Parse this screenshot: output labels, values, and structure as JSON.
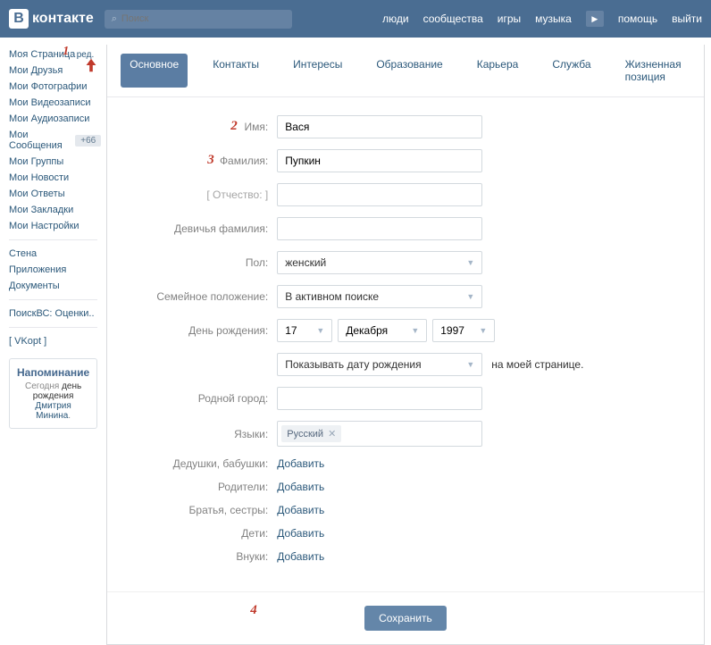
{
  "header": {
    "logo_text": "контакте",
    "search_placeholder": "Поиск",
    "nav": {
      "people": "люди",
      "communities": "сообщества",
      "games": "игры",
      "music": "музыка",
      "help": "помощь",
      "logout": "выйти"
    }
  },
  "sidebar": {
    "my_page": "Моя Страница",
    "edit": "ред.",
    "friends": "Мои Друзья",
    "photos": "Мои Фотографии",
    "videos": "Мои Видеозаписи",
    "audio": "Мои Аудиозаписи",
    "messages": "Мои Сообщения",
    "messages_badge": "+66",
    "groups": "Мои Группы",
    "news": "Мои Новости",
    "answers": "Мои Ответы",
    "bookmarks": "Мои Закладки",
    "settings": "Мои Настройки",
    "wall": "Стена",
    "apps": "Приложения",
    "docs": "Документы",
    "search_vs": "ПоискВС: Оценки..",
    "vkopt": "[ VKopt ]",
    "reminder": {
      "title": "Напоминание",
      "prefix": "Сегодня",
      "mid": "день рождения",
      "name": "Дмитрия Минина",
      "suffix": "."
    }
  },
  "tabs": {
    "main": "Основное",
    "contacts": "Контакты",
    "interests": "Интересы",
    "education": "Образование",
    "career": "Карьера",
    "military": "Служба",
    "life": "Жизненная позиция"
  },
  "form": {
    "name_label": "Имя:",
    "name_value": "Вася",
    "surname_label": "Фамилия:",
    "surname_value": "Пупкин",
    "patronymic_label": "[ Отчество: ]",
    "maiden_label": "Девичья фамилия:",
    "gender_label": "Пол:",
    "gender_value": "женский",
    "marital_label": "Семейное положение:",
    "marital_value": "В активном поиске",
    "bday_label": "День рождения:",
    "bday_day": "17",
    "bday_month": "Декабря",
    "bday_year": "1997",
    "bday_show": "Показывать дату рождения",
    "bday_extra": "на моей странице.",
    "hometown_label": "Родной город:",
    "languages_label": "Языки:",
    "language_tag": "Русский",
    "grandparents_label": "Дедушки, бабушки:",
    "parents_label": "Родители:",
    "siblings_label": "Братья, сестры:",
    "children_label": "Дети:",
    "grandchildren_label": "Внуки:",
    "add_link": "Добавить",
    "save": "Сохранить"
  },
  "annotations": {
    "a1": "1",
    "a2": "2",
    "a3": "3",
    "a4": "4"
  }
}
